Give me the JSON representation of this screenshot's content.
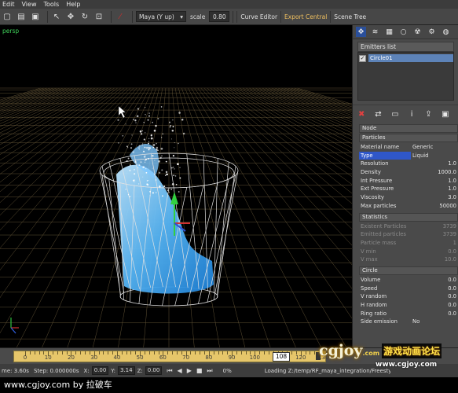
{
  "menu": [
    "Edit",
    "View",
    "Tools",
    "Help"
  ],
  "toolbar": {
    "camera": "Maya (Y up)",
    "scale_label": "scale",
    "scale_value": "0.80",
    "curve_editor": "Curve Editor",
    "export_central": "Export Central",
    "scene_tree": "Scene Tree"
  },
  "viewport": {
    "label": "persp"
  },
  "emitters": {
    "header": "Emitters list",
    "item": "Circle01"
  },
  "node": {
    "node_label": "Node",
    "particles_label": "Particles",
    "rows": [
      {
        "k": "Material name",
        "v": "Generic"
      },
      {
        "k": "Type",
        "v": "Liquid"
      },
      {
        "k": "Resolution",
        "v": "1.0"
      },
      {
        "k": "Density",
        "v": "1000.0"
      },
      {
        "k": "Int Pressure",
        "v": "1.0"
      },
      {
        "k": "Ext Pressure",
        "v": "1.0"
      },
      {
        "k": "Viscosity",
        "v": "3.0"
      },
      {
        "k": "Max particles",
        "v": "50000"
      }
    ],
    "statistics_label": "Statistics",
    "stats": [
      {
        "k": "Existent Particles",
        "v": "3739"
      },
      {
        "k": "Emitted particles",
        "v": "3739"
      },
      {
        "k": "Particle mass",
        "v": "1"
      },
      {
        "k": "V min",
        "v": "0.0"
      },
      {
        "k": "V max",
        "v": "10.0"
      }
    ],
    "circle_label": "Circle",
    "circle": [
      {
        "k": "Volume",
        "v": "0.0"
      },
      {
        "k": "Speed",
        "v": "0.0"
      },
      {
        "k": "V random",
        "v": "0.0"
      },
      {
        "k": "H random",
        "v": "0.0"
      },
      {
        "k": "Ring ratio",
        "v": "0.0"
      },
      {
        "k": "Side emission",
        "v": "No"
      }
    ]
  },
  "timeline": {
    "ticks": [
      "0",
      "10",
      "20",
      "30",
      "40",
      "50",
      "60",
      "70",
      "80",
      "90",
      "100",
      "120",
      "130"
    ],
    "current": "108"
  },
  "status": {
    "time": "me: 3.60s",
    "step": "Step: 0.000000s",
    "x_label": "X:",
    "x": "0.00",
    "y_label": "Y:",
    "y": "3.14",
    "z_label": "Z:",
    "z": "0.00",
    "percent": "0%",
    "loading": "Loading Z:/temp/RF_maya_integration/Freestyle 4"
  },
  "caption": "www.cgjoy.com by 拉破车",
  "watermark": {
    "logo": "cgjoy",
    "domain": ".com",
    "cn": "游戏动画论坛",
    "url": "www.cgjoy.com"
  }
}
